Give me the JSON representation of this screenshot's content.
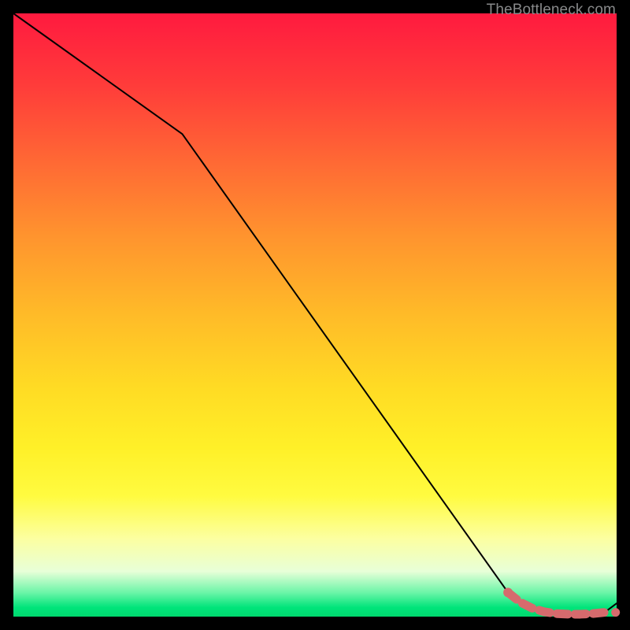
{
  "watermark": "TheBottleneck.com",
  "colors": {
    "line_main": "#000000",
    "line_marker": "#d66a6d",
    "background_black": "#000000"
  },
  "chart_data": {
    "type": "line",
    "title": "",
    "xlabel": "",
    "ylabel": "",
    "xlim": [
      0,
      100
    ],
    "ylim": [
      0,
      100
    ],
    "series": [
      {
        "name": "main-curve",
        "x": [
          0,
          28,
          82,
          84,
          86,
          88,
          90,
          92,
          94,
          96,
          98,
          100
        ],
        "y": [
          100,
          80,
          4,
          2.4,
          1.4,
          0.8,
          0.5,
          0.4,
          0.4,
          0.5,
          0.7,
          2.2
        ]
      }
    ],
    "highlight": {
      "name": "marker-segment",
      "x": [
        82,
        84,
        86,
        88,
        90,
        92,
        94,
        96,
        98
      ],
      "y": [
        4,
        2.4,
        1.4,
        0.8,
        0.5,
        0.4,
        0.4,
        0.5,
        0.7
      ]
    }
  }
}
